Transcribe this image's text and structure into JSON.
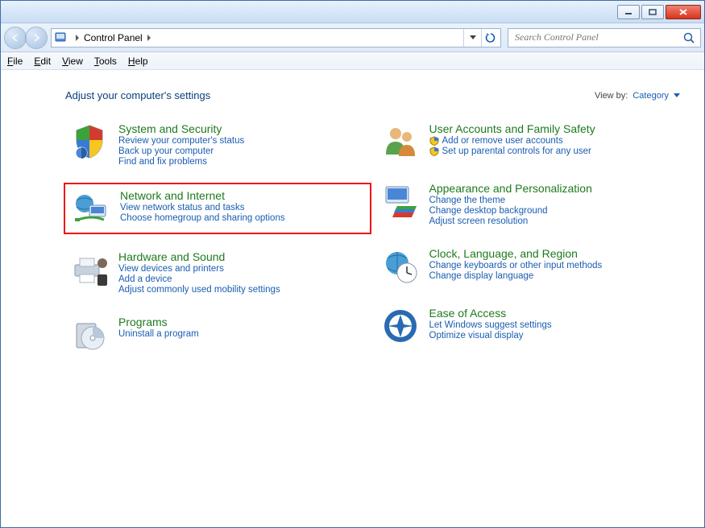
{
  "breadcrumb": {
    "root": "Control Panel"
  },
  "search": {
    "placeholder": "Search Control Panel"
  },
  "menu": {
    "file": "File",
    "edit": "Edit",
    "view": "View",
    "tools": "Tools",
    "help": "Help"
  },
  "header": {
    "title": "Adjust your computer's settings",
    "viewby_label": "View by:",
    "viewby_value": "Category"
  },
  "categories": {
    "system_security": {
      "title": "System and Security",
      "links": [
        "Review your computer's status",
        "Back up your computer",
        "Find and fix problems"
      ]
    },
    "network_internet": {
      "title": "Network and Internet",
      "links": [
        "View network status and tasks",
        "Choose homegroup and sharing options"
      ]
    },
    "hardware_sound": {
      "title": "Hardware and Sound",
      "links": [
        "View devices and printers",
        "Add a device",
        "Adjust commonly used mobility settings"
      ]
    },
    "programs": {
      "title": "Programs",
      "links": [
        "Uninstall a program"
      ]
    },
    "user_accounts": {
      "title": "User Accounts and Family Safety",
      "links": [
        "Add or remove user accounts",
        "Set up parental controls for any user"
      ]
    },
    "appearance": {
      "title": "Appearance and Personalization",
      "links": [
        "Change the theme",
        "Change desktop background",
        "Adjust screen resolution"
      ]
    },
    "clock": {
      "title": "Clock, Language, and Region",
      "links": [
        "Change keyboards or other input methods",
        "Change display language"
      ]
    },
    "ease": {
      "title": "Ease of Access",
      "links": [
        "Let Windows suggest settings",
        "Optimize visual display"
      ]
    }
  }
}
